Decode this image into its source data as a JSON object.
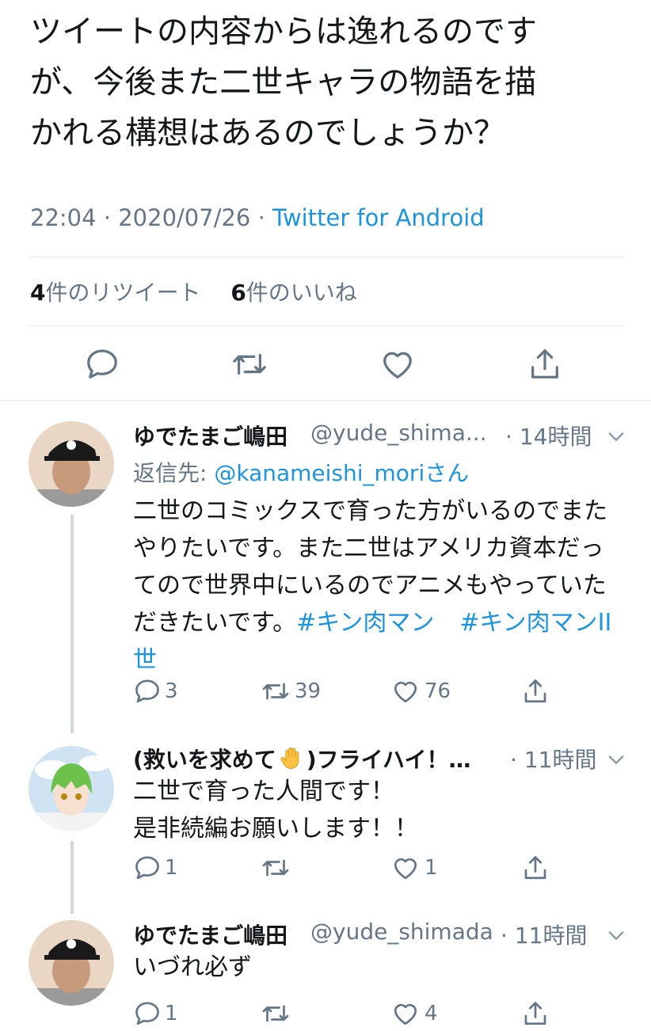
{
  "tweet": {
    "text_line1": "ツイートの内容からは逸れるのです",
    "text_line2": "が、今後また二世キャラの物語を描",
    "text_line3": "かれる構想はあるのでしょうか？",
    "time": "22:04",
    "date": "2020/07/26",
    "source": "Twitter for Android",
    "retweet_count": "4",
    "retweet_label": "件のリツイート",
    "like_count": "6",
    "like_label": "件のいいね"
  },
  "actions": {
    "reply_icon": "reply-icon",
    "retweet_icon": "retweet-icon",
    "like_icon": "heart-icon",
    "share_icon": "share-icon"
  },
  "replies": [
    {
      "name": "ゆでたまご嶋田",
      "handle": "@yude_shima...",
      "time": "14時間",
      "reply_to_prefix": "返信先: ",
      "reply_to_mention": "@kanameishi_mori",
      "reply_to_suffix": "さん",
      "line1": "二世のコミックスで育った方がいるのでまた",
      "line2": "やりたいです。また二世はアメリカ資本だっ",
      "line3": "てので世界中にいるのでアニメもやっていた",
      "line4_text": "だきたいです。",
      "hashtag1": "#キン肉マン",
      "hashtag2": "#キン肉マンII",
      "line5": "世",
      "reply_count": "3",
      "retweet_count": "39",
      "like_count": "76"
    },
    {
      "name_part1": "(救いを求めて",
      "name_part2": ")フライハイ！…",
      "time": "11時間",
      "line1": "二世で育った人間です！",
      "line2": "是非続編お願いします！！",
      "reply_count": "1",
      "like_count": "1"
    },
    {
      "name": "ゆでたまご嶋田",
      "handle": "@yude_shimada",
      "time": "11時間",
      "line1": "いづれ必ず",
      "reply_count": "1",
      "like_count": "4"
    }
  ],
  "colors": {
    "link": "#1b95e0",
    "secondary": "#657786",
    "divider": "#e6ecf0",
    "text": "#14171a"
  }
}
